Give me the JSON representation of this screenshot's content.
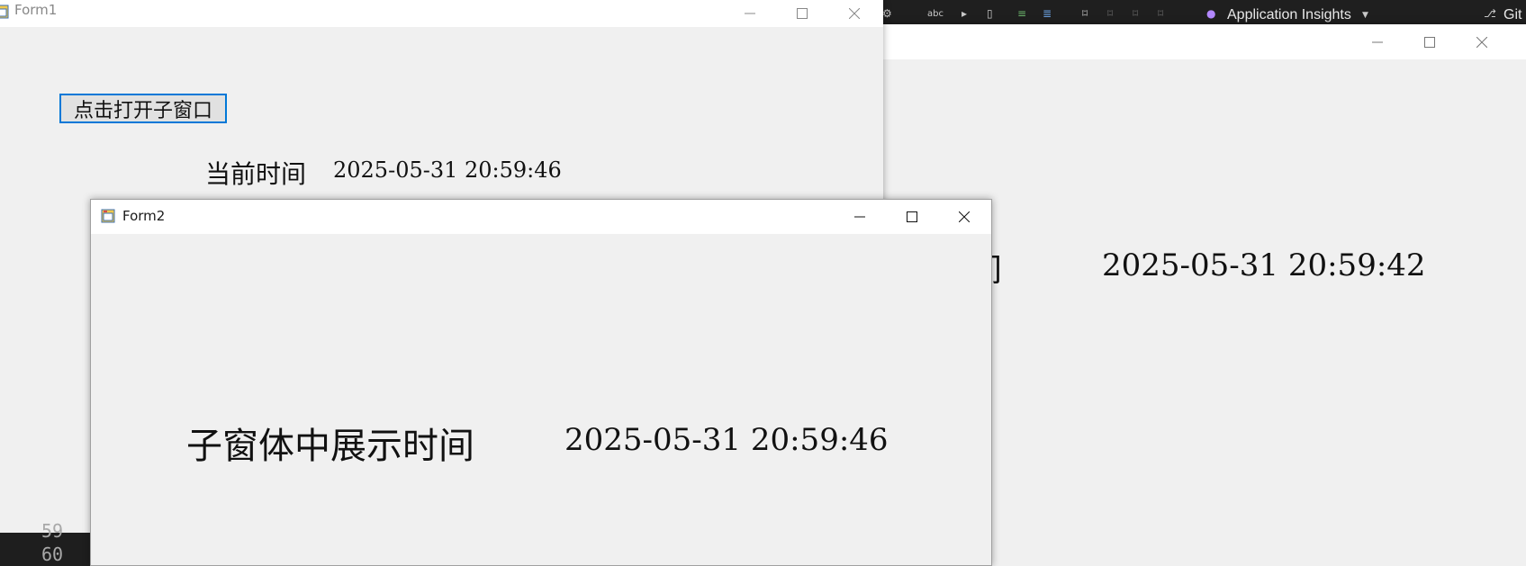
{
  "vs": {
    "app_insights_label": "Application Insights",
    "git_label": "Git",
    "gutter_lines": [
      "59",
      "60"
    ]
  },
  "background_form": {
    "partial_label": "间",
    "time": "2025-05-31 20:59:42"
  },
  "form1": {
    "title": "Form1",
    "open_button_label": "点击打开子窗口",
    "current_time_label": "当前时间",
    "current_time_value": "2025-05-31 20:59:46"
  },
  "form2": {
    "title": "Form2",
    "label": "子窗体中展示时间",
    "time": "2025-05-31 20:59:46"
  },
  "colors": {
    "window_bg": "#f0f0f0",
    "titlebar_bg": "#ffffff",
    "button_border": "#0078d7",
    "ide_dark": "#1e1e1e"
  }
}
